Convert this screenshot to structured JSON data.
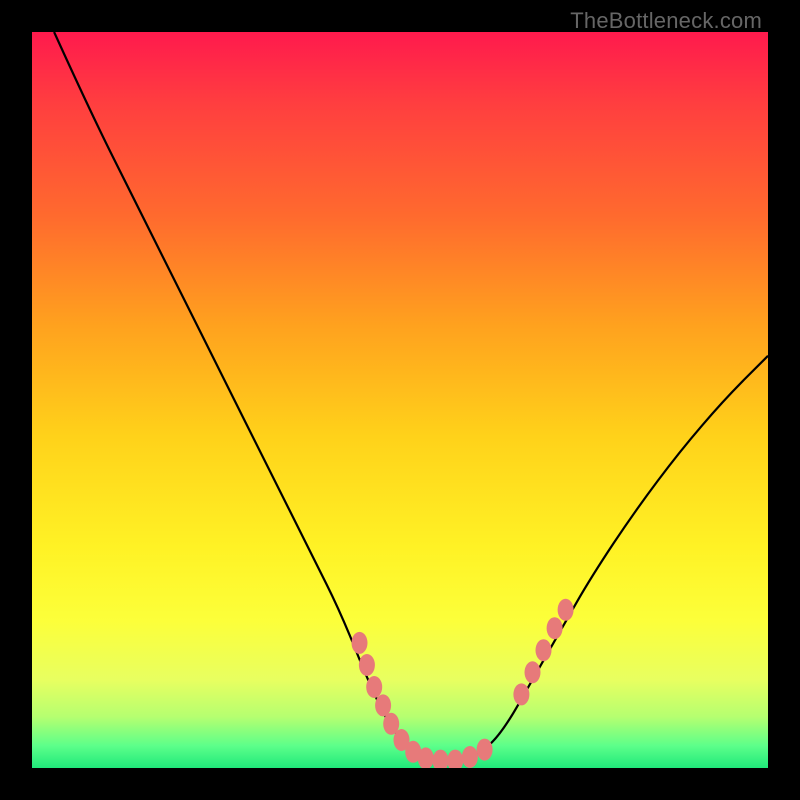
{
  "attribution": "TheBottleneck.com",
  "chart_data": {
    "type": "line",
    "title": "",
    "xlabel": "",
    "ylabel": "",
    "xlim": [
      0,
      100
    ],
    "ylim": [
      0,
      100
    ],
    "curve": {
      "name": "bottleneck-curve",
      "points": [
        {
          "x": 3,
          "y": 100
        },
        {
          "x": 8,
          "y": 89
        },
        {
          "x": 14,
          "y": 77
        },
        {
          "x": 20,
          "y": 65
        },
        {
          "x": 26,
          "y": 53
        },
        {
          "x": 32,
          "y": 41
        },
        {
          "x": 38,
          "y": 29
        },
        {
          "x": 42,
          "y": 21
        },
        {
          "x": 46,
          "y": 11
        },
        {
          "x": 49,
          "y": 5
        },
        {
          "x": 52,
          "y": 2
        },
        {
          "x": 55,
          "y": 1
        },
        {
          "x": 58,
          "y": 1
        },
        {
          "x": 61,
          "y": 2
        },
        {
          "x": 64,
          "y": 5
        },
        {
          "x": 68,
          "y": 12
        },
        {
          "x": 72,
          "y": 19
        },
        {
          "x": 76,
          "y": 26
        },
        {
          "x": 82,
          "y": 35
        },
        {
          "x": 88,
          "y": 43
        },
        {
          "x": 94,
          "y": 50
        },
        {
          "x": 100,
          "y": 56
        }
      ]
    },
    "markers": [
      {
        "x": 44.5,
        "y": 17
      },
      {
        "x": 45.5,
        "y": 14
      },
      {
        "x": 46.5,
        "y": 11
      },
      {
        "x": 47.7,
        "y": 8.5
      },
      {
        "x": 48.8,
        "y": 6
      },
      {
        "x": 50.2,
        "y": 3.8
      },
      {
        "x": 51.8,
        "y": 2.2
      },
      {
        "x": 53.5,
        "y": 1.3
      },
      {
        "x": 55.5,
        "y": 1
      },
      {
        "x": 57.5,
        "y": 1
      },
      {
        "x": 59.5,
        "y": 1.5
      },
      {
        "x": 61.5,
        "y": 2.5
      },
      {
        "x": 66.5,
        "y": 10
      },
      {
        "x": 68.0,
        "y": 13
      },
      {
        "x": 69.5,
        "y": 16
      },
      {
        "x": 71.0,
        "y": 19
      },
      {
        "x": 72.5,
        "y": 21.5
      }
    ],
    "gradient_stops": [
      {
        "offset": 0,
        "color": "#ff1a4d"
      },
      {
        "offset": 10,
        "color": "#ff3f3f"
      },
      {
        "offset": 25,
        "color": "#ff6a2e"
      },
      {
        "offset": 40,
        "color": "#ffa21e"
      },
      {
        "offset": 55,
        "color": "#ffd21a"
      },
      {
        "offset": 70,
        "color": "#fff225"
      },
      {
        "offset": 80,
        "color": "#fcff3a"
      },
      {
        "offset": 88,
        "color": "#e8ff60"
      },
      {
        "offset": 93,
        "color": "#b6ff70"
      },
      {
        "offset": 97,
        "color": "#5cff8a"
      },
      {
        "offset": 100,
        "color": "#20e87a"
      }
    ]
  }
}
